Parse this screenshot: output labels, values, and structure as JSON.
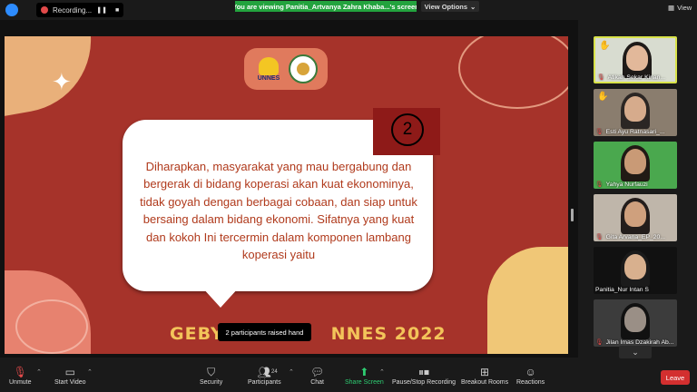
{
  "topbar": {
    "recording_label": "Recording...",
    "viewing_banner": "You are viewing Panitia_Artvanya Zahra Khaba...'s screen",
    "view_options_label": "View Options",
    "view_label": "View"
  },
  "slide": {
    "number": "2",
    "body_text": "Diharapkan, masyarakat yang mau bergabung dan bergerak di bidang koperasi akan kuat ekonominya, tidak goyah dengan berbagai cobaan, dan siap untuk bersaing dalam bidang ekonomi. Sifatnya yang kuat dan kokoh Ini tercermin dalam komponen lambang koperasi yaitu",
    "footer_title": "GEBYA",
    "footer_title_right": "NNES 2022",
    "logo_text": "UNNES"
  },
  "tooltip": {
    "text": "2 participants raised hand"
  },
  "participants": [
    {
      "name": "Atikah Sekar Kinan...",
      "muted": true,
      "hand": true,
      "bg": "#d8dcd0",
      "skin": "#e2b89a",
      "hair": "#1e1a18"
    },
    {
      "name": "Esti Ayu Ratnasari_...",
      "muted": true,
      "hand": true,
      "bg": "#8a7d6e",
      "skin": "#d6ab8c",
      "hair": "#2b2624"
    },
    {
      "name": "Yahya Nurfauzi",
      "muted": true,
      "hand": false,
      "bg": "#4aa84e",
      "skin": "#c99a76",
      "hair": "#211a15"
    },
    {
      "name": "Gita Arvana_EP_20...",
      "muted": true,
      "hand": false,
      "bg": "#bfb6aa",
      "skin": "#cfa07d",
      "hair": "#231d1b"
    },
    {
      "name": "Panitia_Nur Intan S",
      "muted": false,
      "hand": false,
      "bg": "#111111",
      "skin": "#d8b08e",
      "hair": "#1b1b1b"
    },
    {
      "name": "Jilan Imas Dzakirah Ab...",
      "muted": true,
      "hand": false,
      "bg": "#3c3c3c",
      "skin": "#9a8f86",
      "hair": "#111111"
    }
  ],
  "toolbar": {
    "unmute_label": "Unmute",
    "start_video_label": "Start Video",
    "security_label": "Security",
    "participants_label": "Participants",
    "participants_count": "24",
    "chat_label": "Chat",
    "share_screen_label": "Share Screen",
    "pause_recording_label": "Pause/Stop Recording",
    "breakout_rooms_label": "Breakout Rooms",
    "reactions_label": "Reactions",
    "leave_label": "Leave"
  },
  "colors": {
    "slide_bg": "#a6332a",
    "banner_green": "#23a33e",
    "leave_red": "#d32f2f",
    "active_speaker": "#d9e34a"
  }
}
